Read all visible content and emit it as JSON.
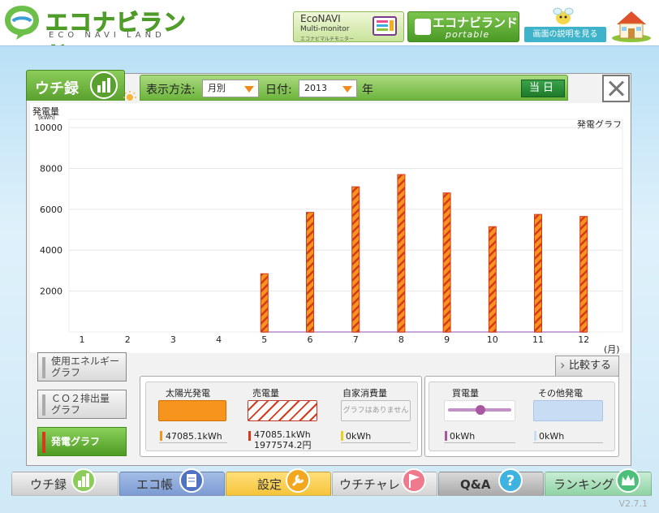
{
  "header": {
    "logo_text": "エコナビランド",
    "logo_sub": "ECO NAVI LAND",
    "multi": {
      "line1": "EcoNAVI",
      "line2": "Multi-monitor",
      "line3": "エコナビマルチモニター"
    },
    "portable": {
      "line1": "エコナビランド",
      "line2": "portable"
    },
    "help_label": "画面の説明を見る"
  },
  "tab": {
    "label": "ウチ録"
  },
  "toolbar": {
    "display_label": "表示方法:",
    "display_value": "月別",
    "date_label": "日付:",
    "year_value": "2013",
    "year_suffix": "年",
    "today_label": "当日"
  },
  "chart_labels": {
    "y_title": "発電量",
    "y_unit": "(kWh)",
    "title": "発電グラフ",
    "x_unit": "(月)"
  },
  "chart_data": {
    "type": "bar",
    "title": "発電グラフ",
    "ylabel": "発電量 (kWh)",
    "xlabel": "(月)",
    "categories": [
      "1",
      "2",
      "3",
      "4",
      "5",
      "6",
      "7",
      "8",
      "9",
      "10",
      "11",
      "12"
    ],
    "values": [
      0,
      0,
      0,
      0,
      2850,
      5850,
      7100,
      7700,
      6800,
      5150,
      5750,
      5650
    ],
    "yticks": [
      2000,
      4000,
      6000,
      8000,
      10000
    ],
    "ylim": [
      0,
      10400
    ],
    "grid": true,
    "colors": {
      "bar_fill": "#f7941e",
      "bar_stripe": "#d63a1a",
      "baseline": "#c9a6d8",
      "grid": "#e6e6e6"
    }
  },
  "side_buttons": {
    "energy": "使用エネルギーグラフ",
    "energy_l1": "使用エネルギー",
    "energy_l2": "グラフ",
    "co2_l1": "ＣＯ２排出量",
    "co2_l2": "グラフ",
    "generation": "発電グラフ"
  },
  "compare_label": "比較する",
  "legend": {
    "solar": {
      "title": "太陽光発電",
      "value": "47085.1kWh",
      "color": "#f7941e"
    },
    "sell": {
      "title": "売電量",
      "value": "47085.1kWh",
      "value2": "1977574.2円",
      "color": "#d63a1a"
    },
    "self": {
      "title": "自家消費量",
      "swatch_text": "グラフはありません",
      "value": "0kWh",
      "color": "#e5d21e"
    },
    "buy": {
      "title": "買電量",
      "value": "0kWh",
      "color": "#a7589f"
    },
    "other": {
      "title": "その他発電",
      "value": "0kWh",
      "color": "#c8dcf4"
    }
  },
  "nav": {
    "uchiroku": "ウチ録",
    "ecocho": "エコ帳",
    "settei": "設定",
    "uchichare": "ウチチャレ",
    "qa": "Q&A",
    "ranking": "ランキング"
  },
  "version": "V2.7.1"
}
